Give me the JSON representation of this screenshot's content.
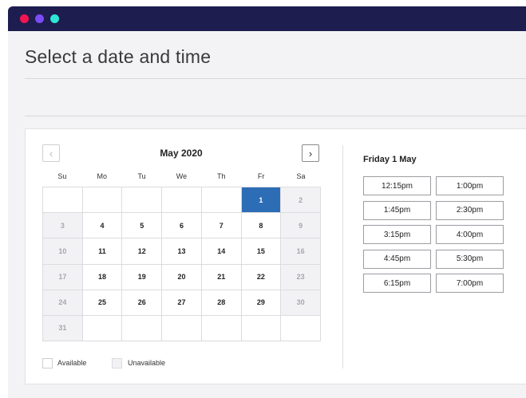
{
  "window": {
    "traffic_lights": [
      "#f21451",
      "#7b4bf5",
      "#2ee6d5"
    ]
  },
  "page": {
    "title": "Select a date and time"
  },
  "calendar": {
    "month_label": "May 2020",
    "prev_icon": "chevron-left-icon",
    "next_icon": "chevron-right-icon",
    "weekdays": [
      "Su",
      "Mo",
      "Tu",
      "We",
      "Th",
      "Fr",
      "Sa"
    ],
    "weeks": [
      [
        "",
        "",
        "",
        "",
        "",
        "1",
        "2"
      ],
      [
        "3",
        "4",
        "5",
        "6",
        "7",
        "8",
        "9"
      ],
      [
        "10",
        "11",
        "12",
        "13",
        "14",
        "15",
        "16"
      ],
      [
        "17",
        "18",
        "19",
        "20",
        "21",
        "22",
        "23"
      ],
      [
        "24",
        "25",
        "26",
        "27",
        "28",
        "29",
        "30"
      ],
      [
        "31",
        "",
        "",
        "",
        "",
        "",
        ""
      ]
    ],
    "selected_day": "1",
    "unavailable_days": [
      "2",
      "3",
      "9",
      "10",
      "16",
      "17",
      "23",
      "24",
      "30",
      "31"
    ],
    "selected_color": "#2d6db5"
  },
  "legend": {
    "available": "Available",
    "unavailable": "Unavailable"
  },
  "times": {
    "heading": "Friday 1 May",
    "slots": [
      "12:15pm",
      "1:00pm",
      "1:45pm",
      "2:30pm",
      "3:15pm",
      "4:00pm",
      "4:45pm",
      "5:30pm",
      "6:15pm",
      "7:00pm"
    ]
  }
}
